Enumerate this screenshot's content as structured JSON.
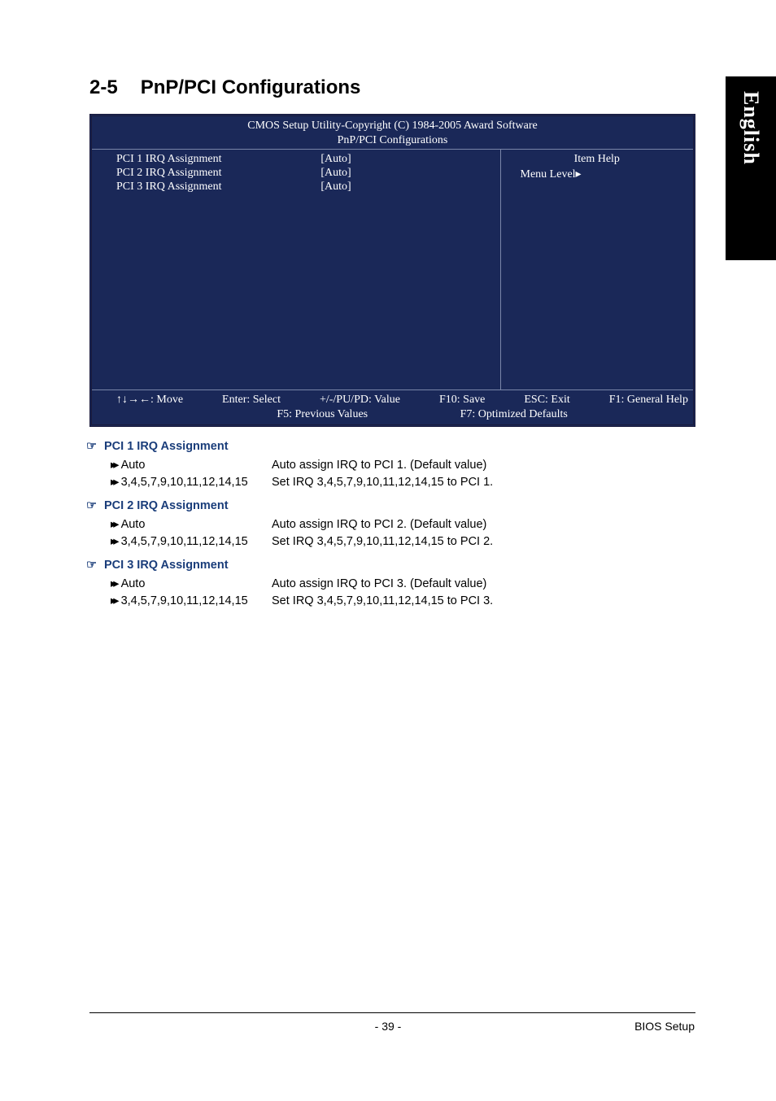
{
  "side_tab": "English",
  "section": {
    "number": "2-5",
    "title": "PnP/PCI Configurations"
  },
  "bios": {
    "header1": "CMOS Setup Utility-Copyright (C) 1984-2005 Award Software",
    "header2": "PnP/PCI Configurations",
    "items": [
      {
        "label": "PCI 1 IRQ Assignment",
        "value": "[Auto]"
      },
      {
        "label": "PCI 2 IRQ Assignment",
        "value": "[Auto]"
      },
      {
        "label": "PCI 3 IRQ Assignment",
        "value": "[Auto]"
      }
    ],
    "help_title": "Item Help",
    "menu_level": "Menu Level",
    "footer": {
      "move": "↑↓→←: Move",
      "enter": "Enter: Select",
      "pupd": "+/-/PU/PD: Value",
      "f10": "F10: Save",
      "esc": "ESC: Exit",
      "f1": "F1: General Help",
      "f5": "F5: Previous Values",
      "f7": "F7: Optimized Defaults"
    }
  },
  "descriptions": [
    {
      "title": "PCI 1 IRQ Assignment",
      "options": [
        {
          "opt": "Auto",
          "desc": "Auto assign IRQ to PCI 1. (Default value)"
        },
        {
          "opt": "3,4,5,7,9,10,11,12,14,15",
          "desc": "Set IRQ 3,4,5,7,9,10,11,12,14,15 to PCI 1."
        }
      ]
    },
    {
      "title": "PCI 2 IRQ Assignment",
      "options": [
        {
          "opt": "Auto",
          "desc": "Auto assign IRQ to PCI 2. (Default value)"
        },
        {
          "opt": "3,4,5,7,9,10,11,12,14,15",
          "desc": "Set IRQ 3,4,5,7,9,10,11,12,14,15 to PCI 2."
        }
      ]
    },
    {
      "title": "PCI 3 IRQ Assignment",
      "options": [
        {
          "opt": "Auto",
          "desc": "Auto assign IRQ to PCI 3. (Default value)"
        },
        {
          "opt": "3,4,5,7,9,10,11,12,14,15",
          "desc": "Set IRQ 3,4,5,7,9,10,11,12,14,15 to PCI 3."
        }
      ]
    }
  ],
  "page_number": "- 39 -",
  "footer_section": "BIOS Setup"
}
